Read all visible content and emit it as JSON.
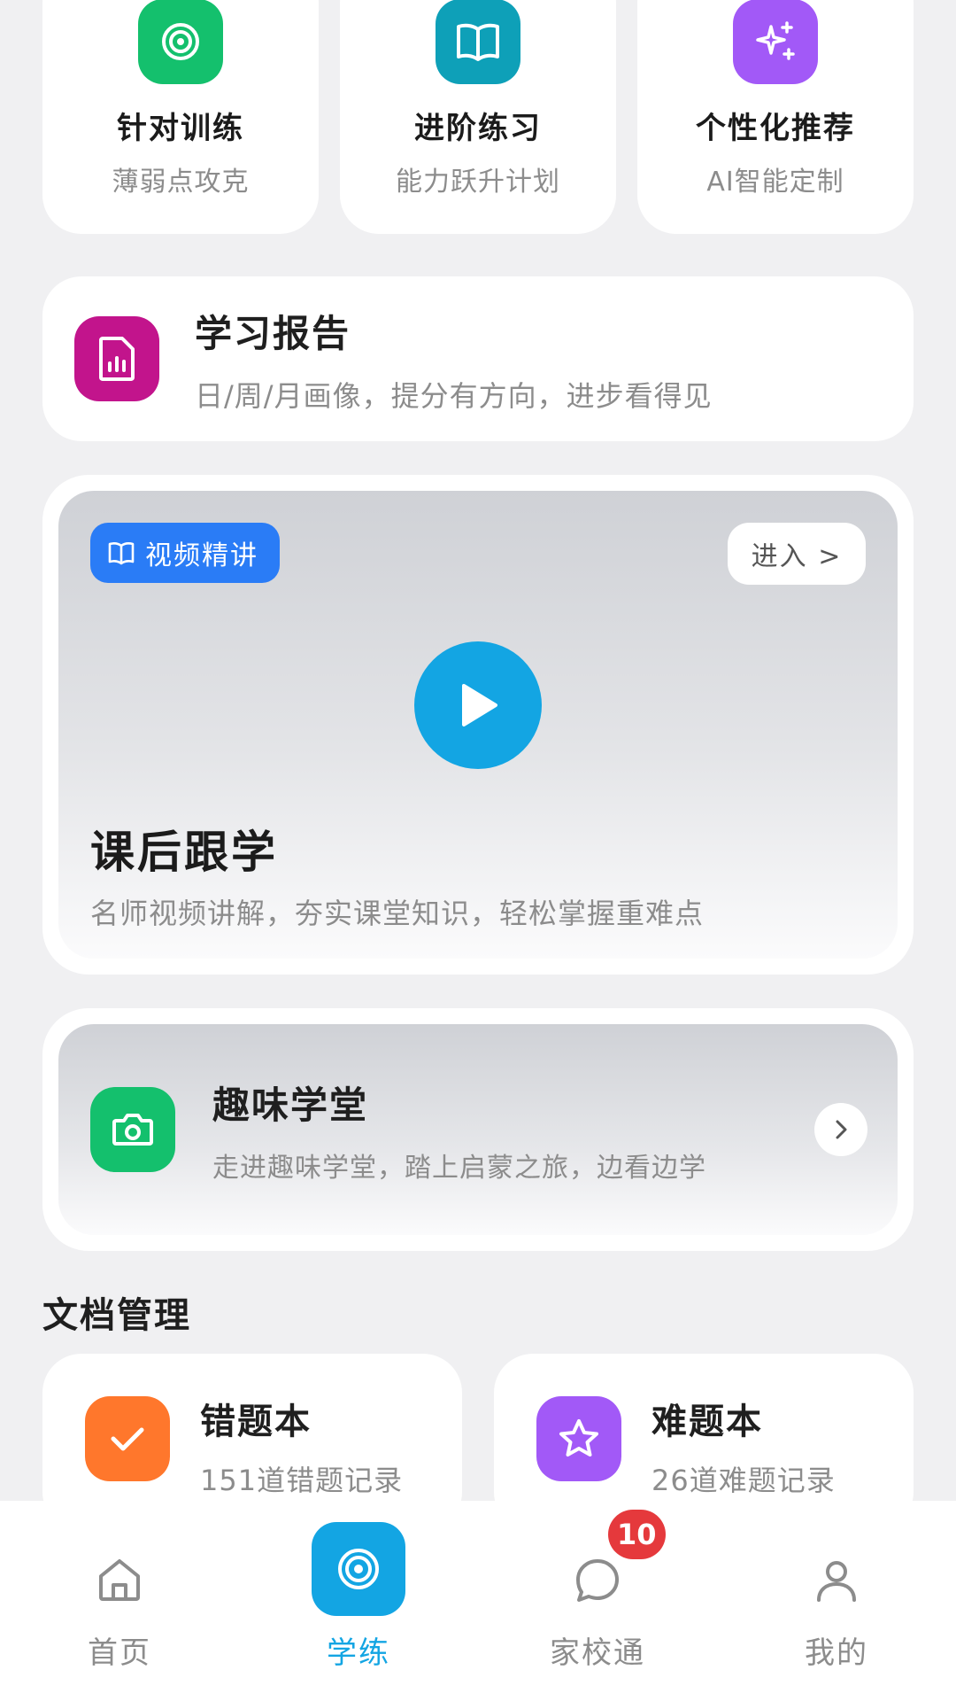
{
  "colors": {
    "accent": "#13a5e3",
    "green": "#14c06d",
    "teal": "#0ea0b8",
    "purple": "#a259f7",
    "magenta": "#c2148c",
    "blue": "#2a7cf6",
    "orange": "#ff772c",
    "badge_red": "#e5393c"
  },
  "quick_cards": [
    {
      "icon": "target-icon",
      "title": "针对训练",
      "subtitle": "薄弱点攻克"
    },
    {
      "icon": "open-book-icon",
      "title": "进阶练习",
      "subtitle": "能力跃升计划"
    },
    {
      "icon": "sparkles-icon",
      "title": "个性化推荐",
      "subtitle": "AI智能定制"
    }
  ],
  "report": {
    "icon": "report-chart-icon",
    "title": "学习报告",
    "subtitle": "日/周/月画像，提分有方向，进步看得见"
  },
  "video": {
    "badge": "视频精讲",
    "enter": "进入 >",
    "title": "课后跟学",
    "subtitle": "名师视频讲解，夯实课堂知识，轻松掌握重难点"
  },
  "fun": {
    "icon": "camera-icon",
    "title": "趣味学堂",
    "subtitle": "走进趣味学堂，踏上启蒙之旅，边看边学"
  },
  "docs": {
    "section_title": "文档管理",
    "items": [
      {
        "icon": "check-icon",
        "title": "错题本",
        "subtitle": "151道错题记录"
      },
      {
        "icon": "star-icon",
        "title": "难题本",
        "subtitle": "26道难题记录"
      }
    ]
  },
  "tabbar": {
    "active": "学练",
    "tabs": [
      {
        "label": "首页",
        "icon": "home-icon"
      },
      {
        "label": "学练",
        "icon": "target-icon"
      },
      {
        "label": "家校通",
        "icon": "chat-bubble-icon",
        "badge": "10"
      },
      {
        "label": "我的",
        "icon": "user-icon"
      }
    ]
  }
}
